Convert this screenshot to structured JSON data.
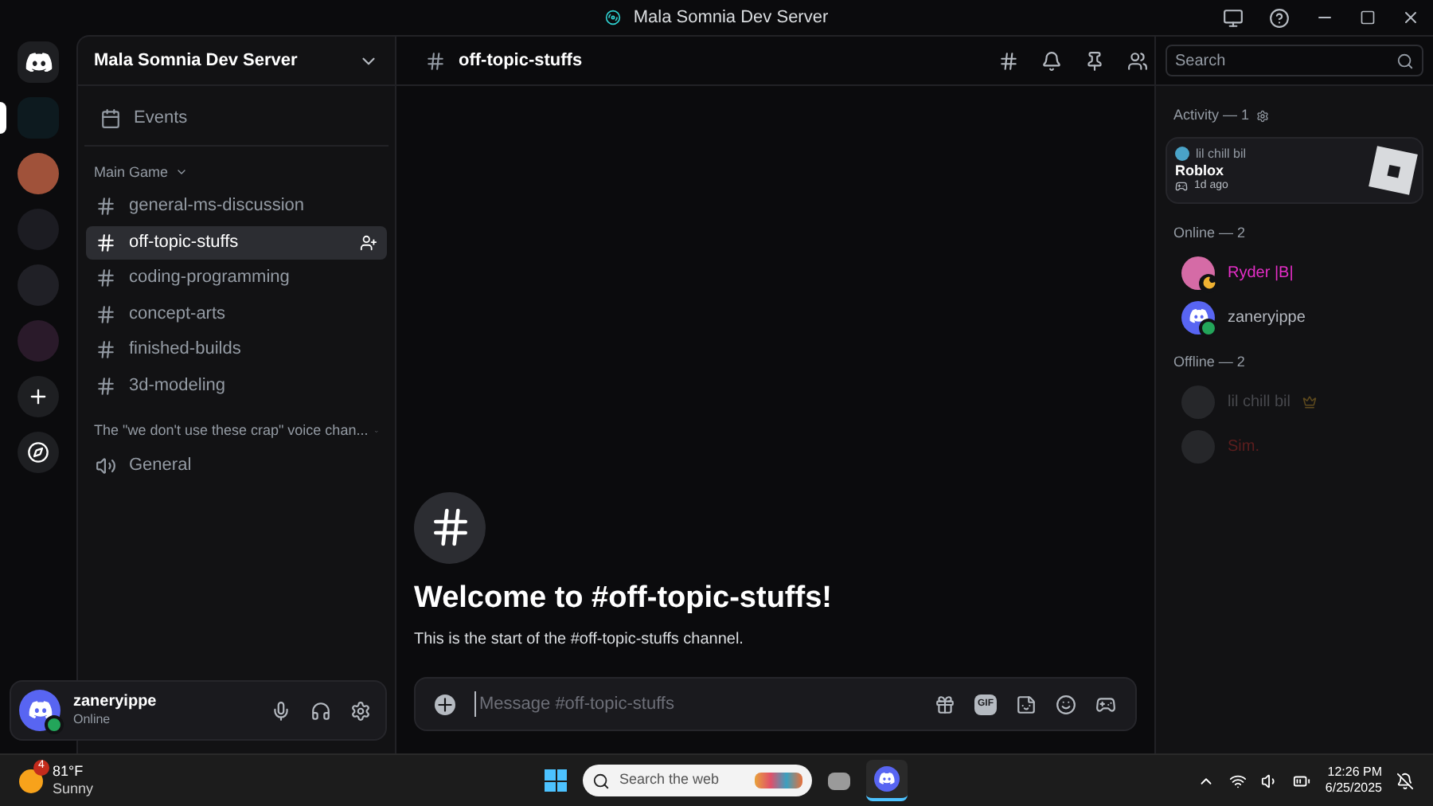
{
  "window": {
    "title": "Mala Somnia Dev Server"
  },
  "servers": [
    {
      "kind": "home",
      "selected": false
    },
    {
      "kind": "server",
      "selected": true,
      "color": "#0d1a1f"
    },
    {
      "kind": "server",
      "selected": false,
      "color": "#a0523a"
    },
    {
      "kind": "server",
      "selected": false,
      "color": "#1c1c22"
    },
    {
      "kind": "server",
      "selected": false,
      "color": "#202026"
    },
    {
      "kind": "server",
      "selected": false,
      "color": "#2a1a2a"
    },
    {
      "kind": "add"
    },
    {
      "kind": "discover"
    }
  ],
  "server_header": {
    "name": "Mala Somnia Dev Server"
  },
  "events": {
    "label": "Events"
  },
  "categories": [
    {
      "name": "Main Game",
      "channels": [
        {
          "name": "general-ms-discussion",
          "kind": "text",
          "selected": false
        },
        {
          "name": "off-topic-stuffs",
          "kind": "text",
          "selected": true
        },
        {
          "name": "coding-programming",
          "kind": "text",
          "selected": false
        },
        {
          "name": "concept-arts",
          "kind": "text",
          "selected": false
        },
        {
          "name": "finished-builds",
          "kind": "text",
          "selected": false
        },
        {
          "name": "3d-modeling",
          "kind": "text",
          "selected": false
        }
      ]
    },
    {
      "name": "The \"we don't use these crap\" voice chan...",
      "channels": [
        {
          "name": "General",
          "kind": "voice",
          "selected": false
        }
      ]
    }
  ],
  "user_panel": {
    "name": "zaneryippe",
    "status": "Online"
  },
  "channel_header": {
    "name": "off-topic-stuffs",
    "search_placeholder": "Search"
  },
  "welcome": {
    "title": "Welcome to #off-topic-stuffs!",
    "subtitle": "This is the start of the #off-topic-stuffs channel."
  },
  "composer": {
    "placeholder": "Message #off-topic-stuffs",
    "gif_label": "GIF"
  },
  "members": {
    "activity_heading": "Activity — 1",
    "activity": {
      "user": "lil chill bil",
      "game": "Roblox",
      "time": "1d ago"
    },
    "groups": [
      {
        "heading": "Online — 2",
        "members": [
          {
            "name": "Ryder |B|",
            "color": "#e62ec8",
            "idle": true,
            "online": false,
            "crown": false
          },
          {
            "name": "zaneryippe",
            "color": "#b5b9c0",
            "idle": false,
            "online": true,
            "crown": false
          }
        ]
      },
      {
        "heading": "Offline — 2",
        "members": [
          {
            "name": "lil chill bil",
            "color": "#47484d",
            "idle": false,
            "online": false,
            "crown": true
          },
          {
            "name": "Sim.",
            "color": "#5c1e1e",
            "idle": false,
            "online": false,
            "crown": false
          }
        ]
      }
    ]
  },
  "taskbar": {
    "weather_badge": "4",
    "temperature": "81°F",
    "condition": "Sunny",
    "search_placeholder": "Search the web",
    "time": "12:26 PM",
    "date": "6/25/2025"
  }
}
